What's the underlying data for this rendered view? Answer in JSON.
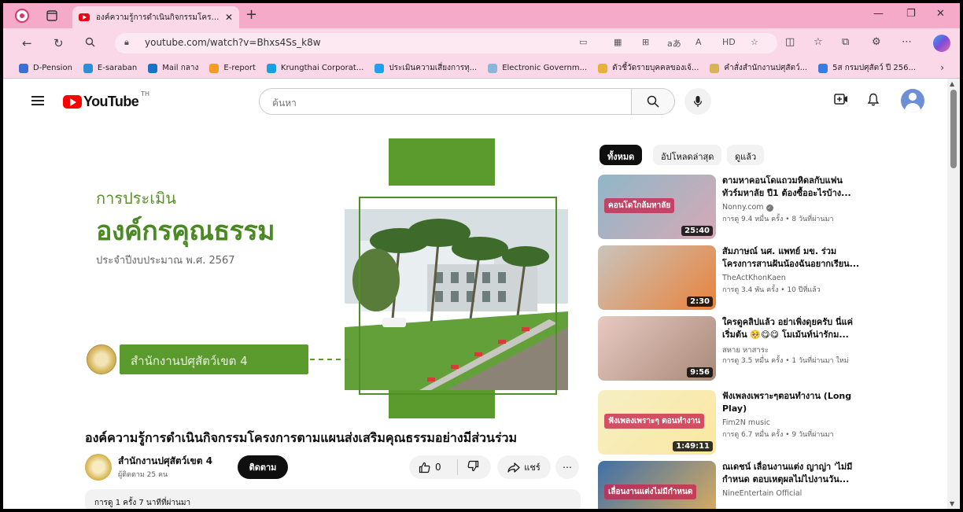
{
  "browser": {
    "tab_title": "องค์ความรู้การดำเนินกิจกรรมโครงการฯ",
    "url": "youtube.com/watch?v=Bhxs4Ss_k8w",
    "url_tool_label": "aあ",
    "bookmarks": [
      {
        "label": "D-Pension",
        "color": "#3b6fd8"
      },
      {
        "label": "E-saraban",
        "color": "#2d8fd5"
      },
      {
        "label": "Mail กลาง",
        "color": "#1a73c8"
      },
      {
        "label": "E-report",
        "color": "#f39b24"
      },
      {
        "label": "Krungthai Corporat...",
        "color": "#19a0e0"
      },
      {
        "label": "ประเมินความเสี่ยงการทุ...",
        "color": "#22a0f0"
      },
      {
        "label": "Electronic Governm...",
        "color": "#8bb6d9"
      },
      {
        "label": "ตัวชี้วัดรายบุคคลของเจ้...",
        "color": "#e9b03a"
      },
      {
        "label": "คำสั่งสำนักงานปศุสัตว์...",
        "color": "#d8b455"
      },
      {
        "label": "5ส กรมปศุสัตว์ ปี 256...",
        "color": "#3b7be0"
      }
    ]
  },
  "youtube": {
    "logo_text": "YouTube",
    "region": "TH",
    "search_placeholder": "ค้นหา"
  },
  "thumbnail": {
    "line1": "การประเมิน",
    "line2": "องค์กรคุณธรรม",
    "line3": "ประจำปีงบประมาณ พ.ศ. 2567",
    "org": "สำนักงานปศุสัตว์เขต 4"
  },
  "video": {
    "title": "องค์ความรู้การดำเนินกิจกรรมโครงการตามแผนส่งเสริมคุณธรรมอย่างมีส่วนร่วม",
    "channel": "สำนักงานปศุสัตว์เขต 4",
    "subscribers": "ผู้ติดตาม 25 คน",
    "subscribe_label": "ติดตาม",
    "likes": "0",
    "share_label": "แชร์",
    "description_meta": "การดู 1 ครั้ง  7 นาทีที่ผ่านมา"
  },
  "chips": [
    "ทั้งหมด",
    "อัปโหลดล่าสุด",
    "ดูแล้ว"
  ],
  "recommendations": [
    {
      "title": "ตามหาคอนโดแถวมหิดลกับแฟน ทัวร์มหาลัย ปี1 ต้องซื้ออะไรบ้าง...",
      "channel": "Nonny.com",
      "verified": true,
      "meta": "การดู 9.4 หมื่น ครั้ง  • 8 วันที่ผ่านมา",
      "duration": "25:40",
      "thumb_text": "คอนโดใกล้มหาลัย",
      "colors": [
        "#8fb7c8",
        "#d7a9b5"
      ]
    },
    {
      "title": "สัมภาษณ์ นศ. แพทย์ มข. ร่วม โครงการสานฝันน้องฉันอยากเรียน...",
      "channel": "TheActKhonKaen",
      "verified": false,
      "meta": "การดู 3.4 พัน ครั้ง  • 10 ปีที่แล้ว",
      "duration": "2:30",
      "thumb_text": "",
      "colors": [
        "#c9c4bd",
        "#e9823a"
      ]
    },
    {
      "title": "ใครดูคลิปแล้ว อย่าเพิ่งดุยครับ นี่แค่เริ่มต้น 🥺😋😋 โมเม้นท์น่ารักม...",
      "channel": "สหาย หาสาระ",
      "verified": false,
      "meta": "การดู 3.5 หมื่น ครั้ง  • 1 วันที่ผ่านมา  ใหม่",
      "duration": "9:56",
      "thumb_text": "",
      "colors": [
        "#e8c9c0",
        "#a88a7a"
      ]
    },
    {
      "title": "ฟังเพลงเพราะๆตอนทำงาน (Long Play)",
      "channel": "Fim2N music",
      "verified": false,
      "meta": "การดู 6.7 หมื่น ครั้ง  • 9 วันที่ผ่านมา",
      "duration": "1:49:11",
      "thumb_text": "ฟังเพลงเพราะๆ ตอนทำงาน",
      "colors": [
        "#f6efc4",
        "#fbe7a0"
      ]
    },
    {
      "title": "ณเดชน์ เลื่อนงานแต่ง ญาญ่า 'ไม่มีกำหนด ตอบเหตุผลไม่ไปงานวัน...",
      "channel": "NineEntertain Official",
      "verified": false,
      "meta": "",
      "duration": "",
      "thumb_text": "เลื่อนงานแต่งไม่มีกำหนด",
      "colors": [
        "#3f6fa8",
        "#e3b05a"
      ]
    }
  ]
}
